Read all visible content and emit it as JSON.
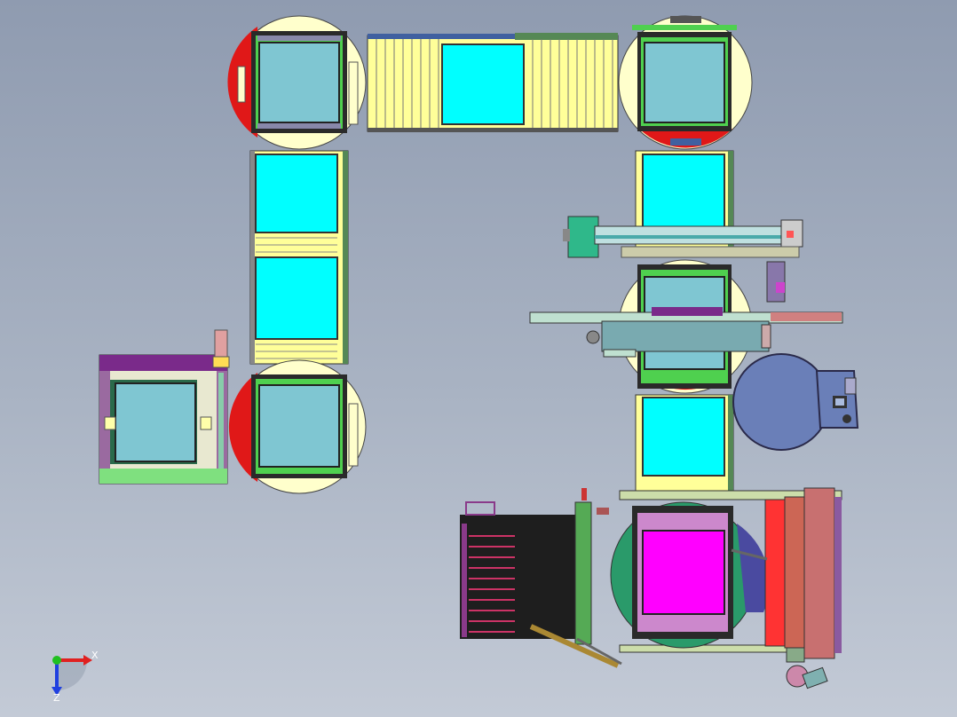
{
  "viewport": {
    "background_top": "#8f9bb0",
    "background_bottom": "#c3cad6"
  },
  "triad": {
    "x_label": "X",
    "z_label": "Z",
    "x_color": "#e02020",
    "z_color": "#2040e0",
    "origin_color": "#20c020"
  },
  "colors": {
    "panel_cyan": "#00ffff",
    "panel_light_cyan": "#7fc6d2",
    "roller_yellow": "#ffff99",
    "turntable_yellow": "#ffffcc",
    "accent_red": "#e01818",
    "magenta_panel": "#ff00ff",
    "frame_purple": "#7a2a8a",
    "frame_green": "#4fd04f",
    "tank_blue": "#6a7fb8",
    "rack_dark": "#1e1e1e",
    "rose_frame": "#c87070"
  },
  "icons": {
    "turntable": "turntable-icon",
    "conveyor": "roller-conveyor-icon",
    "gantry": "gantry-robot-icon",
    "tank": "cylindrical-tank-icon",
    "rack": "cassette-rack-icon",
    "triad": "coordinate-triad-icon"
  }
}
